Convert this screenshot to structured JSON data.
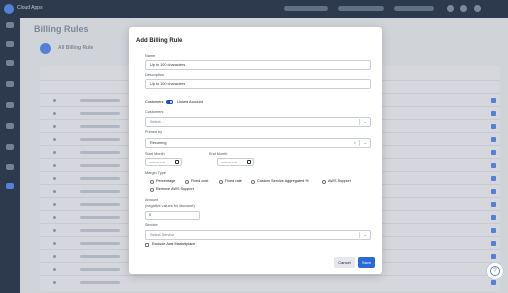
{
  "app": {
    "brand": "Cloud Apps"
  },
  "page": {
    "title": "Billing Rules",
    "tab_label": "All Billing Rule"
  },
  "modal": {
    "title": "Add Billing Rule",
    "name": {
      "label": "Name",
      "value": "Up to 100 characters"
    },
    "description": {
      "label": "Description",
      "value": "Up to 100 characters"
    },
    "scope_toggle": {
      "left_label": "Customers",
      "right_label": "Linked Account"
    },
    "customers": {
      "label": "Customers",
      "placeholder": "Select..."
    },
    "primed_by": {
      "label": "Primed by",
      "value": "Recurring"
    },
    "start_month": {
      "label": "Start Month",
      "value": "-------- ----"
    },
    "end_month": {
      "label": "End Month",
      "value": "-------- ----"
    },
    "margin_type": {
      "label": "Margin Type",
      "options": [
        "Percentage",
        "Fixed cost",
        "Fixed rate",
        "Custom Service Aggregated %",
        "AWS Support",
        "Remove AWS Support"
      ]
    },
    "amount": {
      "label": "Amount",
      "hint": "(negative values for discount)",
      "value": "0"
    },
    "service": {
      "label": "Service",
      "placeholder": "Select Service"
    },
    "exclude": {
      "label": "Exclude Aws Marketplace"
    },
    "cancel_label": "Cancel",
    "save_label": "Save"
  },
  "colors": {
    "primary": "#2c6ad8",
    "sidebar": "#2f3d52",
    "toggle": "#1f4fc2"
  },
  "icons": {
    "help": "help-icon",
    "calendar": "calendar-icon",
    "chevron": "chevron-down-icon"
  }
}
